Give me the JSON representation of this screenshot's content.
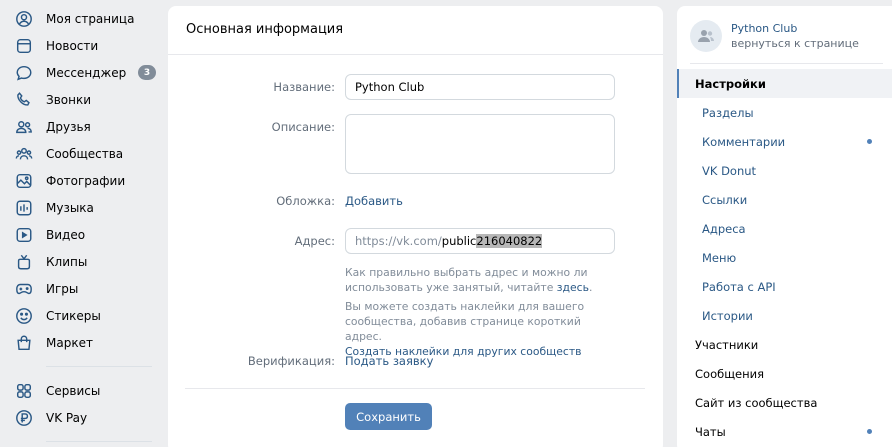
{
  "nav": [
    {
      "id": "my-page",
      "label": "Моя страница",
      "icon": "user-circle-icon"
    },
    {
      "id": "news",
      "label": "Новости",
      "icon": "newspaper-icon"
    },
    {
      "id": "messenger",
      "label": "Мессенджер",
      "icon": "chat-bubble-icon",
      "badge": "3"
    },
    {
      "id": "calls",
      "label": "Звонки",
      "icon": "phone-icon"
    },
    {
      "id": "friends",
      "label": "Друзья",
      "icon": "users-icon"
    },
    {
      "id": "communities",
      "label": "Сообщества",
      "icon": "group-icon"
    },
    {
      "id": "photos",
      "label": "Фотографии",
      "icon": "picture-icon"
    },
    {
      "id": "music",
      "label": "Музыка",
      "icon": "music-bars-icon"
    },
    {
      "id": "video",
      "label": "Видео",
      "icon": "video-icon"
    },
    {
      "id": "clips",
      "label": "Клипы",
      "icon": "clips-icon"
    },
    {
      "id": "games",
      "label": "Игры",
      "icon": "gamepad-icon"
    },
    {
      "id": "stickers",
      "label": "Стикеры",
      "icon": "smile-icon"
    },
    {
      "id": "market",
      "label": "Маркет",
      "icon": "shopping-bag-icon"
    }
  ],
  "nav2": [
    {
      "id": "services",
      "label": "Сервисы",
      "icon": "services-icon"
    },
    {
      "id": "vkpay",
      "label": "VK Pay",
      "icon": "ruble-icon"
    }
  ],
  "main": {
    "title": "Основная информация",
    "name_label": "Название:",
    "name_value": "Python Club",
    "desc_label": "Описание:",
    "desc_value": "",
    "cover_label": "Обложка:",
    "cover_link": "Добавить",
    "address_label": "Адрес:",
    "address_prefix": "https://vk.com/",
    "address_value_start": "public",
    "address_value_sel": "216040822",
    "hint1_text": "Как правильно выбрать адрес и можно ли использовать уже занятый, читайте",
    "hint1_link": "здесь",
    "hint1_end": ".",
    "hint2_text": "Вы можете создать наклейки для вашего сообщества, добавив странице короткий адрес.",
    "hint2_link": "Создать наклейки для других сообществ",
    "verify_label": "Верификация:",
    "verify_link": "Подать заявку",
    "save_label": "Сохранить"
  },
  "right": {
    "club_name": "Python Club",
    "back_label": "вернуться к странице",
    "menu": [
      {
        "id": "settings",
        "label": "Настройки",
        "type": "active"
      },
      {
        "id": "sections",
        "label": "Разделы",
        "type": "sub"
      },
      {
        "id": "comments",
        "label": "Комментарии",
        "type": "sub",
        "dot": true
      },
      {
        "id": "vk-donut",
        "label": "VK Donut",
        "type": "sub"
      },
      {
        "id": "links",
        "label": "Ссылки",
        "type": "sub"
      },
      {
        "id": "addresses",
        "label": "Адреса",
        "type": "sub"
      },
      {
        "id": "menu",
        "label": "Меню",
        "type": "sub"
      },
      {
        "id": "api",
        "label": "Работа с API",
        "type": "sub"
      },
      {
        "id": "stories",
        "label": "Истории",
        "type": "sub"
      },
      {
        "id": "members",
        "label": "Участники",
        "type": "top"
      },
      {
        "id": "messages",
        "label": "Сообщения",
        "type": "top"
      },
      {
        "id": "site",
        "label": "Сайт из сообщества",
        "type": "top"
      },
      {
        "id": "chats",
        "label": "Чаты",
        "type": "top",
        "dot": true
      }
    ]
  },
  "colors": {
    "accent": "#5181b8",
    "link": "#2a5885",
    "muted": "#818c99",
    "bg": "#edeef0"
  }
}
